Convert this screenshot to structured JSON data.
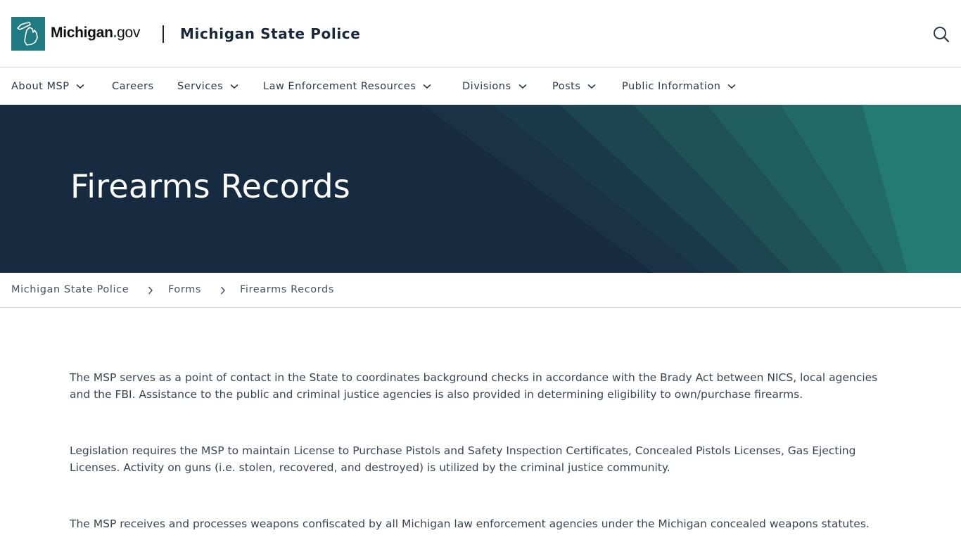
{
  "header": {
    "logo_wordmark_main": "Michigan",
    "logo_wordmark_dot": ".",
    "logo_wordmark_gov": "gov",
    "agency_name": "Michigan State Police"
  },
  "nav": {
    "items": [
      {
        "label": "About MSP",
        "has_dropdown": true
      },
      {
        "label": "Careers",
        "has_dropdown": false
      },
      {
        "label": "Services",
        "has_dropdown": true
      },
      {
        "label": "Law Enforcement Resources",
        "has_dropdown": true
      },
      {
        "label": "Divisions",
        "has_dropdown": true
      },
      {
        "label": "Posts",
        "has_dropdown": true
      },
      {
        "label": "Public Information",
        "has_dropdown": true
      }
    ]
  },
  "hero": {
    "title": "Firearms Records"
  },
  "breadcrumb": {
    "items": [
      "Michigan State Police",
      "Forms",
      "Firearms Records"
    ]
  },
  "content": {
    "paragraphs": [
      "The MSP serves as a point of contact in the State to coordinates background checks in accordance with the Brady Act between NICS, local agencies and the FBI. Assistance to the public and criminal justice agencies is also provided in determining eligibility to own/purchase firearms.",
      "Legislation requires the MSP to maintain License to Purchase Pistols and Safety Inspection Certificates, Concealed Pistols Licenses, Gas Ejecting Licenses. Activity on guns (i.e. stolen, recovered, and destroyed) is utilized by the criminal justice community.",
      "The MSP receives and processes weapons confiscated by all Michigan law enforcement agencies under the Michigan concealed weapons statutes."
    ]
  },
  "colors": {
    "hero_dark": "#172b40",
    "hero_teal": "#247a75",
    "logo_teal": "#1f7a82",
    "gov_dot_green": "#2d8a64"
  },
  "icons": {
    "logo": "michigan-map-icon",
    "search": "search-icon",
    "dropdown": "chevron-down-icon",
    "breadcrumb_separator": "chevron-right-icon"
  }
}
